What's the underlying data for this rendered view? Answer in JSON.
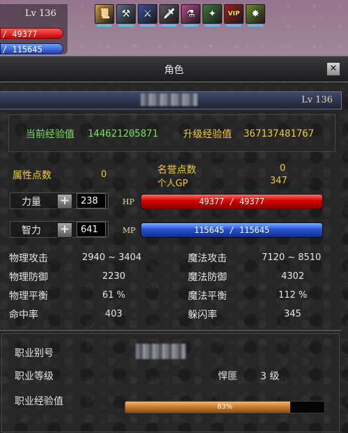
{
  "mini_status": {
    "level": "Lv 136",
    "hp": "/ 49377",
    "mp": "/ 115645"
  },
  "buffs": [
    {
      "icon": "scroll-buff-icon",
      "color": "#d4a23a"
    },
    {
      "icon": "hammer-buff-icon",
      "color": "#5b6d8a"
    },
    {
      "icon": "swords-buff-icon",
      "color": "#3a4f9a"
    },
    {
      "icon": "dagger-buff-icon",
      "color": "#5a5a5a"
    },
    {
      "icon": "potion-buff-icon",
      "color": "#b54a8a"
    },
    {
      "icon": "blade-buff-icon",
      "color": "#3c7a3a"
    },
    {
      "icon": "vip-buff-icon",
      "color": "#a31d1d",
      "text": "VIP"
    },
    {
      "icon": "creature-buff-icon",
      "color": "#6a8a2a"
    }
  ],
  "window": {
    "title": "角色",
    "close": "✕"
  },
  "header": {
    "level": "Lv 136"
  },
  "experience": {
    "current_label": "当前经验值",
    "current_value": "144621205871",
    "next_label": "升级经验值",
    "next_value": "367137481767"
  },
  "points": {
    "attr_label": "属性点数",
    "attr_value": "0",
    "honor_label": "名誉点数",
    "honor_value": "0",
    "gp_label": "个人GP",
    "gp_value": "347"
  },
  "primary": {
    "str_label": "力量",
    "str_value": "238",
    "int_label": "智力",
    "int_value": "641",
    "hp_tag": "HP",
    "hp_text": "49377 / 49377",
    "mp_tag": "MP",
    "mp_text": "115645 / 115645"
  },
  "stats": {
    "phys_atk_label": "物理攻击",
    "phys_atk_value": "2940 ~ 3404",
    "mag_atk_label": "魔法攻击",
    "mag_atk_value": "7120 ~ 8510",
    "phys_def_label": "物理防御",
    "phys_def_value": "2230",
    "mag_def_label": "魔法防御",
    "mag_def_value": "4302",
    "phys_bal_label": "物理平衡",
    "phys_bal_value": "61 %",
    "mag_bal_label": "魔法平衡",
    "mag_bal_value": "112 %",
    "hit_label": "命中率",
    "hit_value": "403",
    "dodge_label": "躲闪率",
    "dodge_value": "345"
  },
  "job": {
    "alias_label": "职业别号",
    "level_label": "职业等级",
    "rank_name": "悍匪",
    "rank_level": "3 级",
    "exp_label": "职业经验值",
    "exp_text": "83%",
    "exp_fraction": 0.83
  }
}
